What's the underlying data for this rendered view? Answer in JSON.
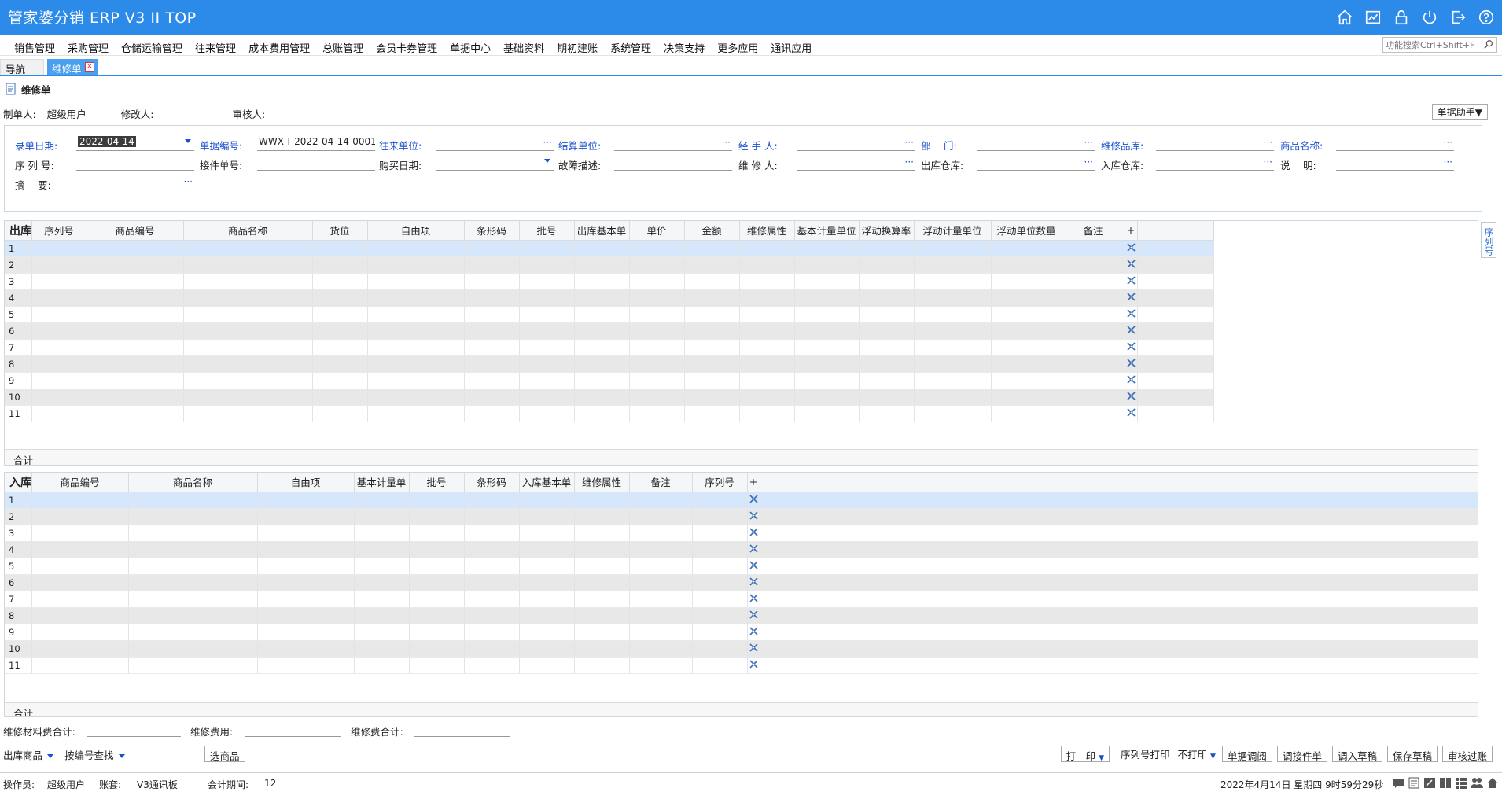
{
  "app": {
    "title": "管家婆分销 ERP V3 II TOP"
  },
  "toolbar_icons": [
    "home-icon",
    "chart-icon",
    "lock-icon",
    "power-icon",
    "logout-icon",
    "help-icon"
  ],
  "menu": [
    "销售管理",
    "采购管理",
    "仓储运输管理",
    "往来管理",
    "成本费用管理",
    "总账管理",
    "会员卡券管理",
    "单据中心",
    "基础资料",
    "期初建账",
    "系统管理",
    "决策支持",
    "更多应用",
    "通讯应用"
  ],
  "search": {
    "placeholder": "功能搜索Ctrl+Shift+F"
  },
  "tabs": {
    "nav": "导航",
    "active": "维修单"
  },
  "doc": {
    "title": "维修单",
    "maker_label": "制单人:",
    "maker_value": "超级用户",
    "modifier_label": "修改人:",
    "auditor_label": "审核人:",
    "helper_button": "单据助手▼"
  },
  "form": {
    "entry_date_label": "录单日期:",
    "entry_date_value": "2022-04-14",
    "doc_no_label": "单据编号:",
    "doc_no_value": "WWX-T-2022-04-14-0001",
    "partner_label": "往来单位:",
    "settle_label": "结算单位:",
    "handler_label": "经 手 人:",
    "dept_label": "部　 门:",
    "repair_warehouse_label": "维修品库:",
    "product_name_label": "商品名称:",
    "serial_label": "序 列 号:",
    "receipt_no_label": "接件单号:",
    "purchase_date_label": "购买日期:",
    "fault_label": "故障描述:",
    "repairer_label": "维 修 人:",
    "out_warehouse_label": "出库仓库:",
    "in_warehouse_label": "入库仓库:",
    "note_label": "说　 明:",
    "summary_label": "摘　 要:"
  },
  "out_grid": {
    "corner": "出库",
    "columns": [
      "序列号",
      "商品编号",
      "商品名称",
      "货位",
      "自由项",
      "条形码",
      "批号",
      "出库基本单",
      "单价",
      "金额",
      "维修属性",
      "基本计量单位",
      "浮动换算率",
      "浮动计量单位",
      "浮动单位数量",
      "备注",
      "+"
    ],
    "rows": [
      "1",
      "2",
      "3",
      "4",
      "5",
      "6",
      "7",
      "8",
      "9",
      "10",
      "11"
    ],
    "sum_label": "合计"
  },
  "in_grid": {
    "corner": "入库",
    "columns": [
      "商品编号",
      "商品名称",
      "自由项",
      "基本计量单",
      "批号",
      "条形码",
      "入库基本单",
      "维修属性",
      "备注",
      "序列号",
      "+"
    ],
    "rows": [
      "1",
      "2",
      "3",
      "4",
      "5",
      "6",
      "7",
      "8",
      "9",
      "10",
      "11"
    ],
    "sum_label": "合计"
  },
  "side_tab": "序列号",
  "totals": {
    "material_label": "维修材料费合计:",
    "fee_label": "维修费用:",
    "fee_total_label": "维修费合计:"
  },
  "bottom": {
    "out_goods": "出库商品",
    "search_by": "按编号查找",
    "pick_goods": "选商品",
    "print": "打　印",
    "serial_print_label": "序列号打印",
    "no_print": "不打印",
    "buttons": [
      "单据调阅",
      "调接件单",
      "调入草稿",
      "保存草稿",
      "审核过账"
    ]
  },
  "status": {
    "operator_label": "操作员:",
    "operator_value": "超级用户",
    "account_label": "账套:",
    "account_value": "V3通讯板",
    "period_label": "会计期间:",
    "period_value": "12",
    "datetime": "2022年4月14日  星期四  9时59分29秒"
  },
  "colors": {
    "accent": "#2c8ae8",
    "label_blue": "#1a4fcf",
    "selected_row": "#d6e6fb"
  }
}
